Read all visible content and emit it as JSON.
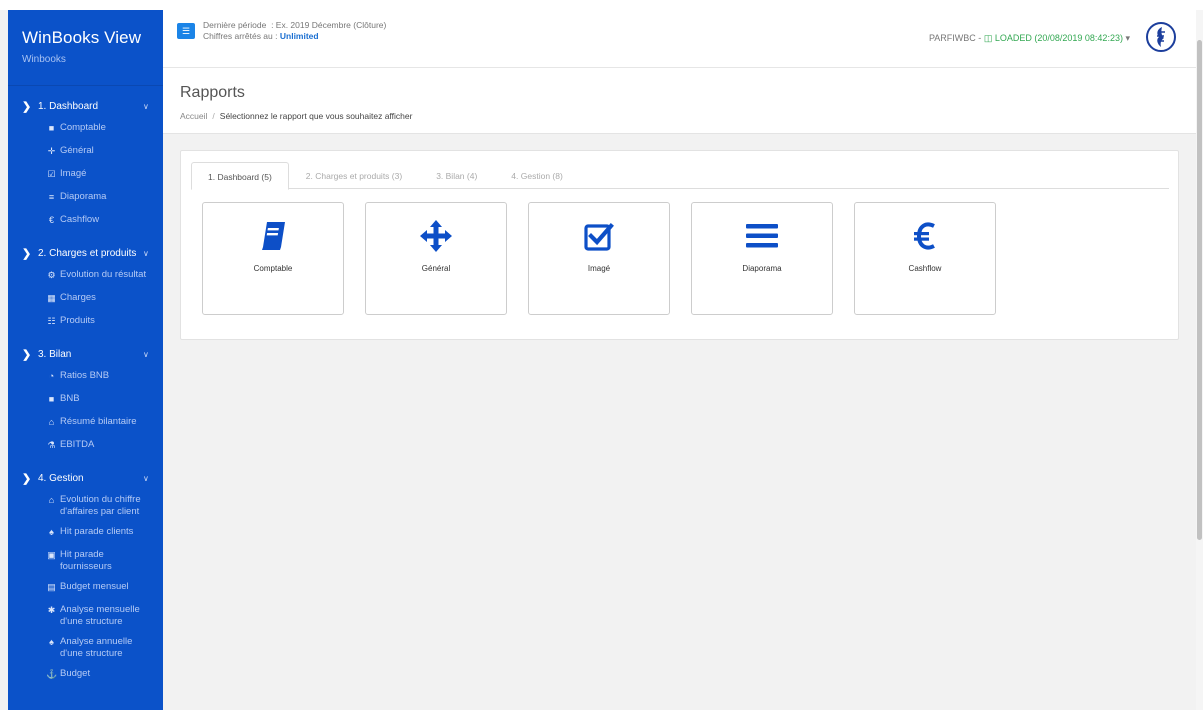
{
  "app": {
    "title": "WinBooks View",
    "subtitle": "Winbooks"
  },
  "topbar": {
    "period_label": "Dernière période",
    "period_value": ": Ex. 2019 Décembre (Clôture)",
    "figures_label": "Chiffres arrêtés au :",
    "figures_value": "Unlimited",
    "db_name": "PARFIWBC -",
    "loaded_label": "LOADED",
    "loaded_time": "(20/08/2019 08:42:23)",
    "dropdown_caret": "▾"
  },
  "page": {
    "title": "Rapports",
    "breadcrumb_home": "Accueil",
    "breadcrumb_sep": "/",
    "breadcrumb_current": "Sélectionnez le rapport que vous souhaitez afficher"
  },
  "tabs": [
    {
      "label": "1. Dashboard (5)"
    },
    {
      "label": "2. Charges et produits (3)"
    },
    {
      "label": "3. Bilan (4)"
    },
    {
      "label": "4. Gestion (8)"
    }
  ],
  "tiles": [
    {
      "label": "Comptable",
      "icon": "book-icon"
    },
    {
      "label": "Général",
      "icon": "arrows-move-icon"
    },
    {
      "label": "Imagé",
      "icon": "check-square-icon"
    },
    {
      "label": "Diaporama",
      "icon": "list-icon"
    },
    {
      "label": "Cashflow",
      "icon": "euro-icon"
    }
  ],
  "sidebar": {
    "sections": [
      {
        "label": "1. Dashboard",
        "items": [
          {
            "label": "Comptable",
            "icon": "book-icon"
          },
          {
            "label": "Général",
            "icon": "arrows-move-icon"
          },
          {
            "label": "Imagé",
            "icon": "check-square-icon"
          },
          {
            "label": "Diaporama",
            "icon": "list-icon"
          },
          {
            "label": "Cashflow",
            "icon": "euro-icon"
          }
        ]
      },
      {
        "label": "2. Charges et produits",
        "items": [
          {
            "label": "Evolution du résultat",
            "icon": "cogs-icon"
          },
          {
            "label": "Charges",
            "icon": "table-icon"
          },
          {
            "label": "Produits",
            "icon": "building-icon"
          }
        ]
      },
      {
        "label": "3. Bilan",
        "items": [
          {
            "label": "Ratios BNB",
            "icon": "gauge-icon"
          },
          {
            "label": "BNB",
            "icon": "book-icon"
          },
          {
            "label": "Résumé bilantaire",
            "icon": "bank-icon"
          },
          {
            "label": "EBITDA",
            "icon": "flask-icon"
          }
        ]
      },
      {
        "label": "4. Gestion",
        "items": [
          {
            "label": "Evolution du chiffre d'affaires par client",
            "icon": "bank-icon"
          },
          {
            "label": "Hit parade clients",
            "icon": "trophy-icon"
          },
          {
            "label": "Hit parade fournisseurs",
            "icon": "car-icon"
          },
          {
            "label": "Budget mensuel",
            "icon": "calendar-icon"
          },
          {
            "label": "Analyse mensuelle d'une structure",
            "icon": "asterisk-icon"
          },
          {
            "label": "Analyse annuelle d'une structure",
            "icon": "trophy-icon"
          },
          {
            "label": "Budget",
            "icon": "anchor-icon"
          }
        ]
      }
    ]
  },
  "colors": {
    "sidebar": "#0b52c9",
    "accent": "#1b84e7",
    "icon_blue": "#0d4fc7",
    "loaded": "#33a852"
  }
}
